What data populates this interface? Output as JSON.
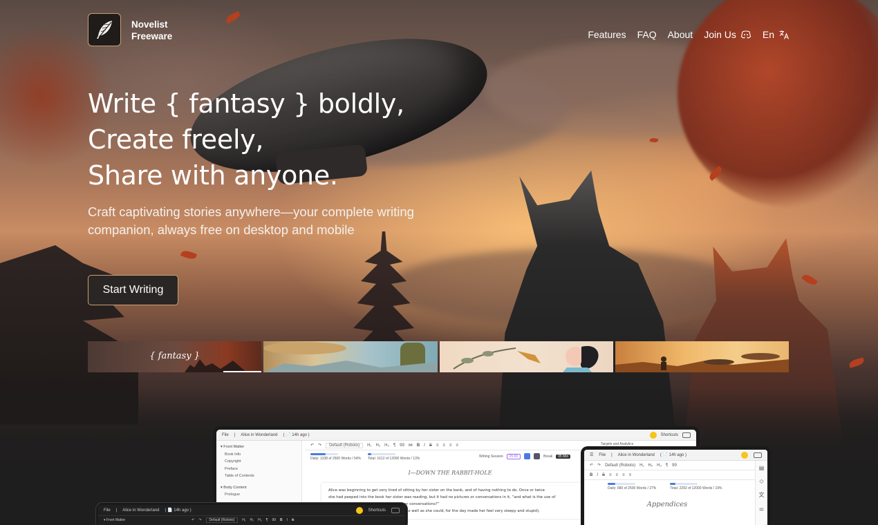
{
  "brand": {
    "line1": "Novelist",
    "line2": "Freeware"
  },
  "nav": {
    "features": "Features",
    "faq": "FAQ",
    "about": "About",
    "join": "Join Us",
    "lang": "En"
  },
  "hero": {
    "line1": "Write { fantasy } boldly,",
    "line2": "Create freely,",
    "line3": "Share with anyone.",
    "sub1": "Craft captivating stories anywhere—your complete writing",
    "sub2": "companion, always free on desktop and mobile",
    "cta": "Start Writing"
  },
  "themes": {
    "active_label": "{ fantasy }"
  },
  "desktop_app": {
    "menu_file": "File",
    "doc_title": "Alice in Wonderland",
    "saved": "( 📄 14h ago )",
    "shortcuts": "Shortcuts",
    "font": "Default (Roboto)",
    "daily": "Daily: 1338 of 2500 Words / 54%",
    "total": "Total: 1612 of 12000 Words / 13%",
    "session_label": "Writing Session",
    "session_time": "25:00",
    "break_label": "Break",
    "break_time": "05 Min",
    "side_front": "Front Matter",
    "side_items": [
      "Book Info",
      "Copyright",
      "Preface",
      "Table of Contents"
    ],
    "side_body": "Body Content",
    "side_body_items": [
      "Prologue"
    ],
    "chapter": "I—DOWN THE RABBIT-HOLE",
    "para1": "Alice was beginning to get very tired of sitting by her sister on the bank, and of having nothing to do. Once or twice",
    "para2": "she had peeped into the book her sister was reading, but it had no pictures or conversations in it, “and what is the use of",
    "para3": "a book,” thought Alice “without pictures or conversations?”",
    "para4": "So she was considering in her own mind (as well as she could, for the day made her feel very sleepy and stupid),",
    "right_panel": "Targets and Analytics"
  },
  "tablet_app": {
    "menu_file": "File",
    "doc_title": "Alice in Wonderland",
    "saved": "( 📄 14h ago )",
    "font": "Default (Roboto)",
    "daily": "Daily: 680 of 2500 Words / 27%",
    "total": "Total: 2292 of 12000 Words / 19%",
    "heading": "Appendices"
  },
  "dark_app": {
    "menu_file": "File",
    "doc_title": "Alice in Wonderland",
    "saved": "( 📄 14h ago )",
    "shortcuts": "Shortcuts",
    "font": "Default (Roboto)",
    "side_front": "Front Matter"
  },
  "colors": {
    "accent_border": "#c9a175",
    "progress": "#4a7be0",
    "session": "#9b6cf0"
  }
}
